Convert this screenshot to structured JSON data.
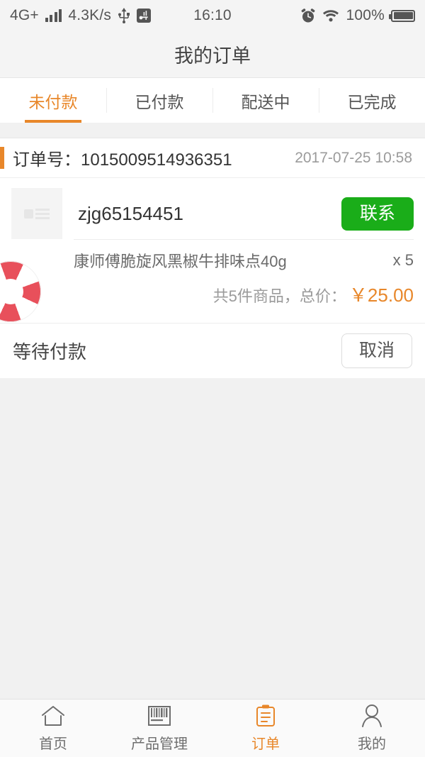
{
  "colors": {
    "accent_orange": "#e8872a",
    "contact_green": "#1aad19",
    "page_bg": "#f1f1f1",
    "card_bg": "#ffffff",
    "text_primary": "#333333",
    "text_muted": "#9b9b9b"
  },
  "statusbar": {
    "network": "4G+",
    "speed": "4.3K/s",
    "usb_icon": "usb-icon",
    "signal_icon": "signal-bars-icon",
    "extra_icon": "vpn-key-icon",
    "time": "16:10",
    "alarm_icon": "alarm-clock-icon",
    "wifi_icon": "wifi-icon",
    "battery_text": "100%",
    "battery_icon": "battery-full-icon"
  },
  "header": {
    "title": "我的订单"
  },
  "tabs": [
    {
      "label": "未付款",
      "active": true
    },
    {
      "label": "已付款",
      "active": false
    },
    {
      "label": "配送中",
      "active": false
    },
    {
      "label": "已完成",
      "active": false
    }
  ],
  "order": {
    "order_no_label": "订单号：",
    "order_no": "1015009514936351",
    "order_no_full": "订单号：1015009514936351",
    "date": "2017-07-25 10:58",
    "seller_name": "zjg65154451",
    "seller_thumb_icon": "broken-image-placeholder-icon",
    "contact_label": "联系",
    "product": {
      "image_icon": "lifebuoy-product-image",
      "name": "康师傅脆旋风黑椒牛排味点40g",
      "qty": "x 5"
    },
    "total_label": "共5件商品，总价：",
    "total_price": "￥25.00",
    "status_text": "等待付款",
    "cancel_label": "取消"
  },
  "bottomnav": [
    {
      "label": "首页",
      "icon": "home-icon",
      "active": false
    },
    {
      "label": "产品管理",
      "icon": "barcode-icon",
      "active": false
    },
    {
      "label": "订单",
      "icon": "clipboard-icon",
      "active": true
    },
    {
      "label": "我的",
      "icon": "person-icon",
      "active": false
    }
  ]
}
